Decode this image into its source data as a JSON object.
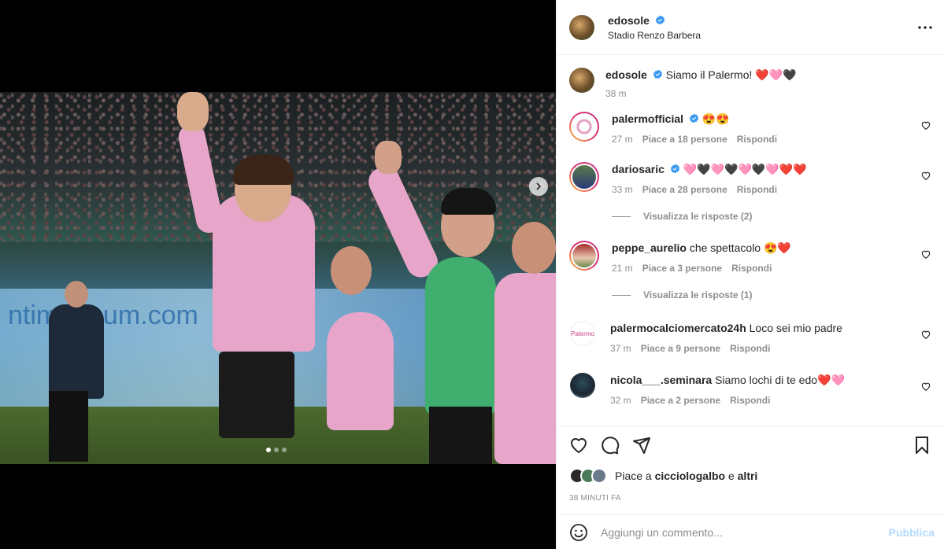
{
  "post": {
    "username": "edosole",
    "location": "Stadio Renzo Barbera",
    "caption_text": "Siamo il Palermo! ❤️🩷🖤",
    "caption_time": "38 m"
  },
  "comments": [
    {
      "username": "palermofficial",
      "text": "😍😍",
      "time": "27 m",
      "likes": "Piace a 18 persone",
      "reply": "Rispondi",
      "verified": true
    },
    {
      "username": "dariosaric",
      "text": "🩷🖤🩷🖤🩷🖤🩷❤️❤️",
      "time": "33 m",
      "likes": "Piace a 28 persone",
      "reply": "Rispondi",
      "verified": true,
      "view_replies": "Visualizza le risposte (2)"
    },
    {
      "username": "peppe_aurelio",
      "text": "che spettacolo 😍❤️",
      "time": "21 m",
      "likes": "Piace a 3 persone",
      "reply": "Rispondi",
      "verified": false,
      "view_replies": "Visualizza le risposte (1)"
    },
    {
      "username": "palermocalciomercato24h",
      "text": "Loco sei mio padre",
      "time": "37 m",
      "likes": "Piace a 9 persone",
      "reply": "Rispondi",
      "verified": false
    },
    {
      "username": "nicola___.seminara",
      "text": "Siamo lochi di te edo❤️🩷",
      "time": "32 m",
      "likes": "Piace a 2 persone",
      "reply": "Rispondi",
      "verified": false
    }
  ],
  "likes_summary": {
    "prefix": "Piace a ",
    "user": "cicciologalbo",
    "middle": " e ",
    "others": "altri"
  },
  "posted_ago": "38 MINUTI FA",
  "composer": {
    "placeholder": "Aggiungi un commento...",
    "publish_label": "Pubblica"
  },
  "media": {
    "banner_text": "ntimo   mum.com"
  },
  "colors": {
    "verified": "#3897f0",
    "publish_disabled": "#b3dbff",
    "heart_red": "#c8102e"
  }
}
